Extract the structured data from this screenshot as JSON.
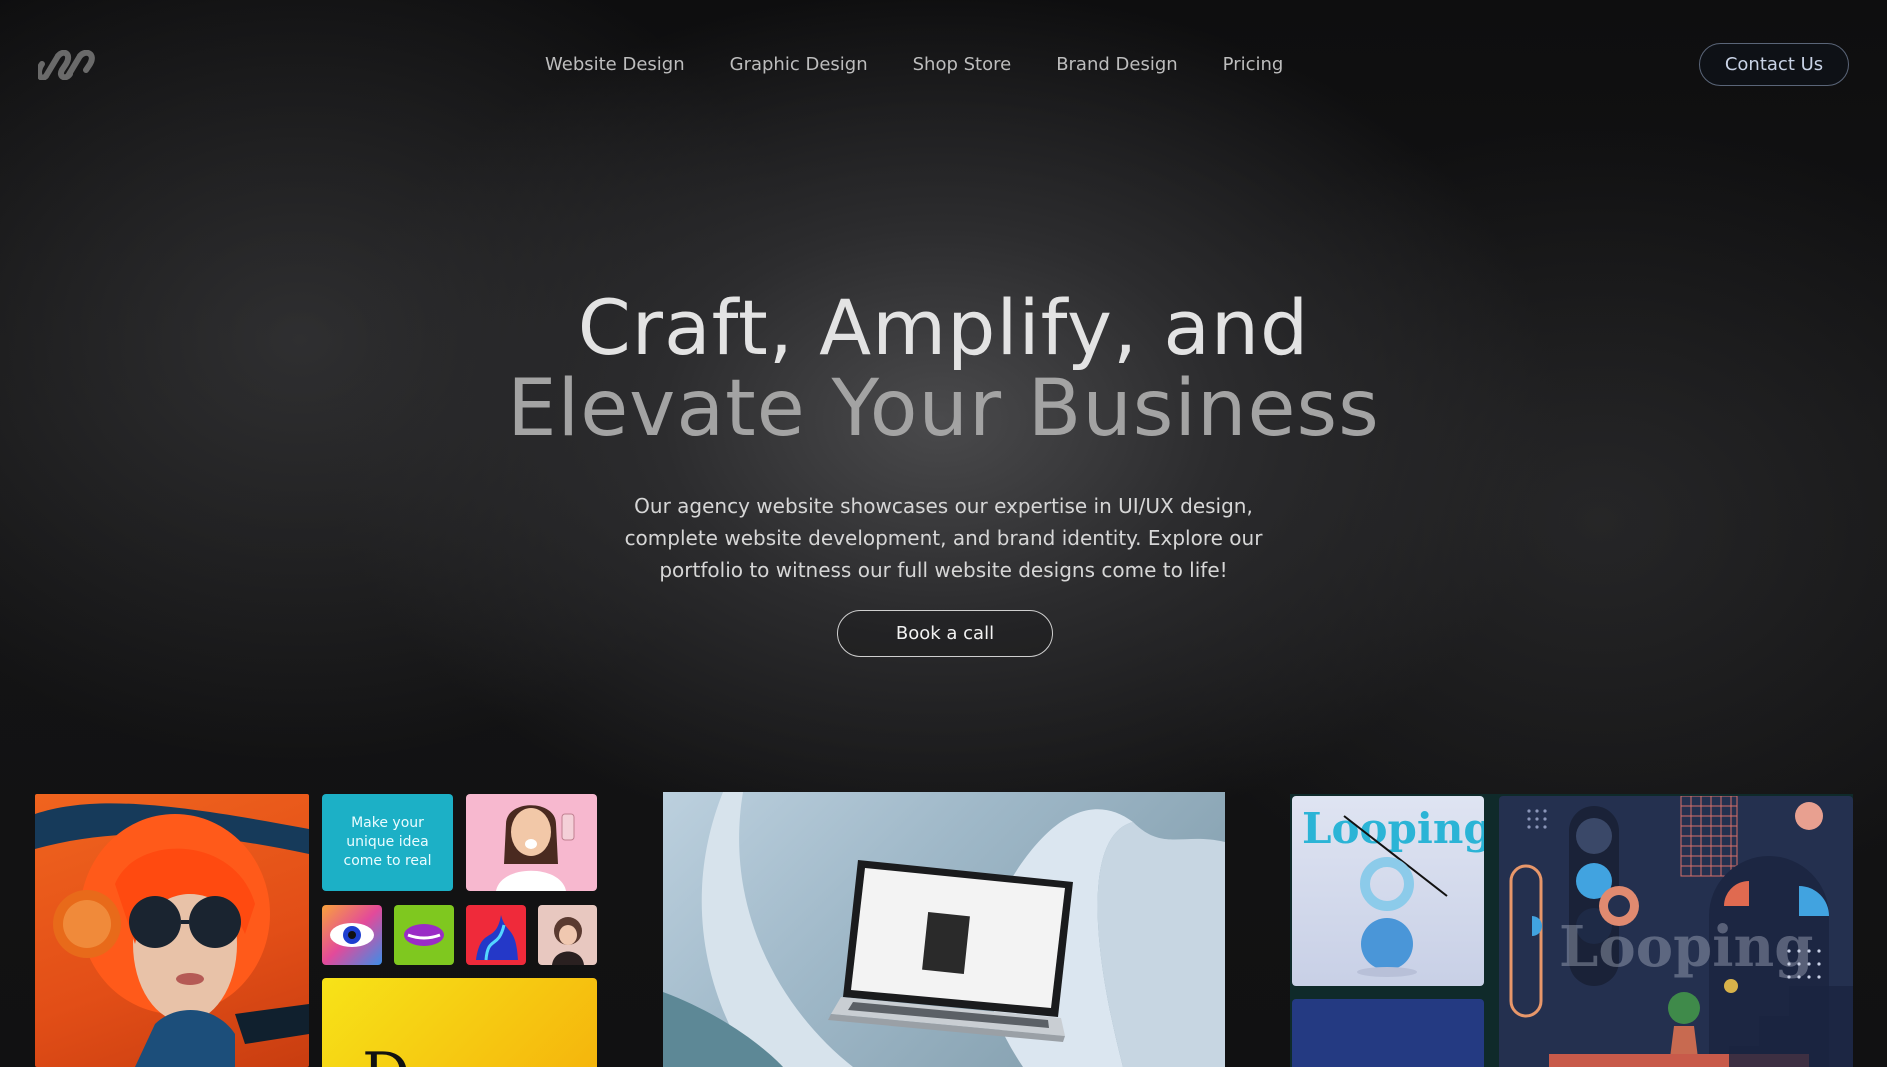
{
  "nav": {
    "logo_icon": "infinity-chain-logo",
    "items": [
      {
        "label": "Website Design"
      },
      {
        "label": "Graphic Design"
      },
      {
        "label": "Shop Store"
      },
      {
        "label": "Brand Design"
      },
      {
        "label": "Pricing"
      }
    ],
    "contact_label": "Contact Us"
  },
  "hero": {
    "title_line1": "Craft, Amplify, and",
    "title_line2": "Elevate Your Business",
    "description": "Our agency website showcases our expertise in UI/UX design, complete website development, and brand identity. Explore our portfolio to witness our full website designs come to life!",
    "cta_label": "Book a call"
  },
  "gallery": {
    "card1": {
      "tile_text": "Make your unique idea come to real",
      "letter": "D"
    },
    "card3": {
      "brand_text": "Looping",
      "poster_text": "Looping"
    }
  },
  "colors": {
    "background": "#0b0b0c",
    "orange": "#e8541f",
    "teal": "#1ab3c9",
    "pink": "#f5b4cd",
    "yellow": "#f5d012",
    "navy": "#2a3556",
    "accent_blue": "#41a3e0"
  }
}
